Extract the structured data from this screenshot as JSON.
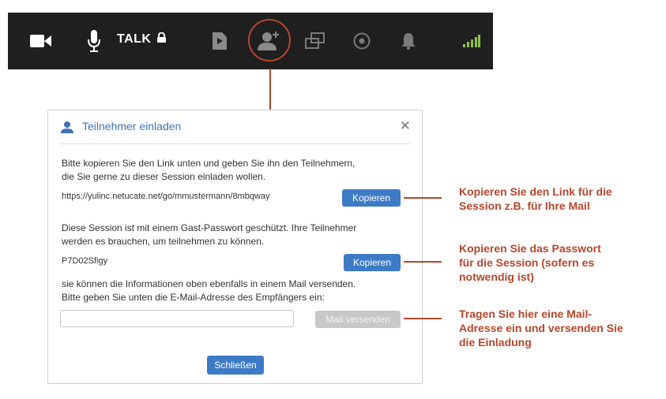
{
  "toolbar": {
    "talk_label": "TALK",
    "icons": [
      "video-camera-icon",
      "microphone-icon",
      "lock-icon",
      "document-play-icon",
      "add-participant-icon",
      "screen-share-icon",
      "record-icon",
      "bell-icon",
      "signal-strength-icon"
    ],
    "colors": {
      "background": "#1f1f1f",
      "icon": "#ffffff",
      "icon_dim": "#7a7a7a",
      "signal": "#8bc34a",
      "highlight": "#b5472b"
    }
  },
  "dialog": {
    "title": "Teilnehmer einladen",
    "close_label": "✕",
    "para1_line1": "Bitte kopieren Sie den Link unten und geben Sie ihn den Teilnehmern,",
    "para1_line2": "die Sie gerne zu dieser Session einladen wollen.",
    "link": "https://yulinc.netucate.net/go/mmustermann/8mbqway",
    "copy_link_label": "Kopieren",
    "para2_line1": "Diese Session ist mit einem Gast-Passwort geschützt. Ihre Teilnehmer",
    "para2_line2": "werden es brauchen, um teilnehmen zu können.",
    "password": "P7D02Sfigy",
    "copy_password_label": "Kopieren",
    "para3_line1": "sie können die Informationen oben ebenfalls in einem Mail versenden.",
    "para3_line2": "Bitte geben Sie unten die E-Mail-Adresse des Empfängers ein:",
    "email_value": "",
    "send_mail_label": "Mail versenden",
    "close_button_label": "Schließen",
    "colors": {
      "primary": "#3e7bc6",
      "disabled": "#c8c8c8",
      "title": "#3e74b3"
    }
  },
  "callouts": {
    "c1_line1": "Kopieren Sie den Link für die",
    "c1_line2": "Session z.B. für Ihre Mail",
    "c2_line1": "Kopieren Sie das Passwort",
    "c2_line2": "für die Session (sofern es",
    "c2_line3": "notwendig ist)",
    "c3_line1": "Tragen Sie hier eine Mail-",
    "c3_line2": "Adresse ein und versenden Sie",
    "c3_line3": "die Einladung",
    "color": "#b5472b"
  }
}
